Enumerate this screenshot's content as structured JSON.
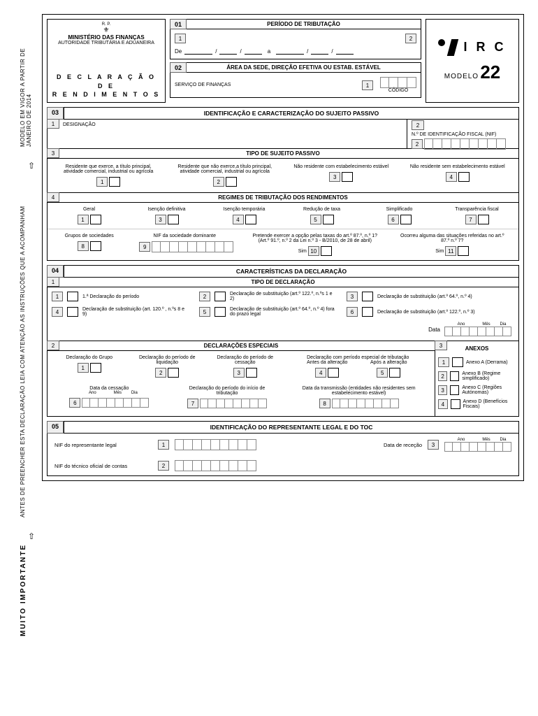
{
  "side": {
    "validity": "MODELO EM VIGOR A PARTIR DE JANEIRO DE 2014",
    "instructions": "ANTES DE PREENCHER ESTA DECLARAÇÃO LEIA COM ATENÇÃO AS INSTRUÇÕES QUE A ACOMPANHAM",
    "important": "MUITO  IMPORTANTE"
  },
  "header": {
    "rp": "R.    P.",
    "ministry": "MINISTÉRIO DAS FINANÇAS",
    "authority": "AUTORIDADE TRIBUTÁRIA E ADUANEIRA",
    "decl1": "D E C L A R A Ç Ã O",
    "decl2": "D E",
    "decl3": "R E N D I M E N T O S",
    "irc": "I R C",
    "modelo": "MODELO",
    "modelo_num": "22"
  },
  "panel01": {
    "num": "01",
    "title": "PERÍODO DE TRIBUTAÇÃO",
    "n1": "1",
    "n2": "2",
    "de": "De",
    "a": "a"
  },
  "panel02": {
    "num": "02",
    "title": "ÁREA DA SEDE, DIREÇÃO EFETIVA OU ESTAB. ESTÁVEL",
    "serv": "SERVIÇO DE FINANÇAS",
    "n1": "1",
    "codigo": "CÓDIGO"
  },
  "sec03": {
    "num": "03",
    "title": "IDENTIFICAÇÃO E CARACTERIZAÇÃO DO SUJEITO PASSIVO",
    "sub1": "1",
    "sub2": "2",
    "desig": "DESIGNAÇÃO",
    "nif_label": "N.º DE IDENTIFICAÇÃO FISCAL (NIF)",
    "nif_n": "2",
    "sub3": "3",
    "tipo": "TIPO DE SUJEITO PASSIVO",
    "opt1": "Residente que exerce, a título principal, atividade comercial, industrial ou agrícola",
    "opt2": "Residente que não exerce,a título principal, atividade comercial, industrial ou agrícola",
    "opt3": "Não residente com estabelecimento estável",
    "opt4": "Não residente sem estabelecimento estável",
    "n": {
      "1": "1",
      "2": "2",
      "3": "3",
      "4": "4"
    },
    "sub4": "4",
    "regimes": "REGIMES DE TRIBUTAÇÃO DOS RENDIMENTOS",
    "reg": {
      "geral": "Geral",
      "isdef": "Isenção definitiva",
      "istmp": "Isenção temporária",
      "red": "Redução de taxa",
      "simp": "Simplificado",
      "trans": "Transparência fiscal",
      "grupos": "Grupos de sociedades",
      "nifdom": "NIF da sociedade dominante",
      "opcao": "Pretende exercer a opção pelas taxas do art.º 87.º, n.º 1?\n(Art.º 91.º, n.º 2 da Lei n.º 3 - B/2010, de 28 de abril)",
      "ocorreu": "Ocorreu alguma das situações referidas no art.º 87.º n.º 7?",
      "sim": "Sim",
      "n1": "1",
      "n3": "3",
      "n4": "4",
      "n5": "5",
      "n6": "6",
      "n7": "7",
      "n8": "8",
      "n9": "9",
      "n10": "10",
      "n11": "11"
    }
  },
  "sec04": {
    "num": "04",
    "title": "CARACTERÍSTICAS DA DECLARAÇÃO",
    "sub1": "1",
    "tipo": "TIPO DE DECLARAÇÃO",
    "items": {
      "1": "1.ª Declaração do período",
      "2": "Declaração de substituição (art.º 122.º, n.ºs 1 e 2)",
      "3": "Declaração de substituição (art.º 64.º, n.º 4)",
      "4": "Declaração de substituição (art. 120.º , n.ºs 8 e 9)",
      "5": "Declaração de substituição (art.º 64.º, n.º 4) fora do prazo legal",
      "6": "Declaração de substituição (art.º 122.º, n.º 3)"
    },
    "n": {
      "1": "1",
      "2": "2",
      "3": "3",
      "4": "4",
      "5": "5",
      "6": "6"
    },
    "data": "Data",
    "ano": "Ano",
    "mes": "Mês",
    "dia": "Dia",
    "sub2": "2",
    "esp_title": "DECLARAÇÕES ESPECIAIS",
    "sub3": "3",
    "anexos": "ANEXOS",
    "esp": {
      "grupo": "Declaração do Grupo",
      "liq": "Declaração do período de liquidação",
      "cess": "Declaração do período de cessação",
      "bracket": "Declaração com período especial de tributação",
      "antes": "Antes da alteração",
      "apos": "Após a alteração",
      "datacess": "Data da cessação",
      "inicio": "Declaração do período do início de tributação",
      "transm": "Data da transmissão (entidades não residentes sem estabelecimento estável)",
      "n1": "1",
      "n2": "2",
      "n3": "3",
      "n4": "4",
      "n5": "5",
      "n6": "6",
      "n7": "7",
      "n8": "8"
    },
    "anexo": {
      "a": "Anexo A (Derrama)",
      "b": "Anexo B (Regime simplificado)",
      "c": "Anexo C (Regiões Autónomas)",
      "d": "Anexo D (Benefícios Fiscais)",
      "n1": "1",
      "n2": "2",
      "n3": "3",
      "n4": "4"
    }
  },
  "sec05": {
    "num": "05",
    "title": "IDENTIFICAÇÃO DO REPRESENTANTE LEGAL E DO TOC",
    "nif_rep": "NIF do representante legal",
    "nif_toc": "NIF do técnico oficial de contas",
    "rec": "Data de receção",
    "n1": "1",
    "n2": "2",
    "n3": "3",
    "ano": "Ano",
    "mes": "Mês",
    "dia": "Dia"
  }
}
